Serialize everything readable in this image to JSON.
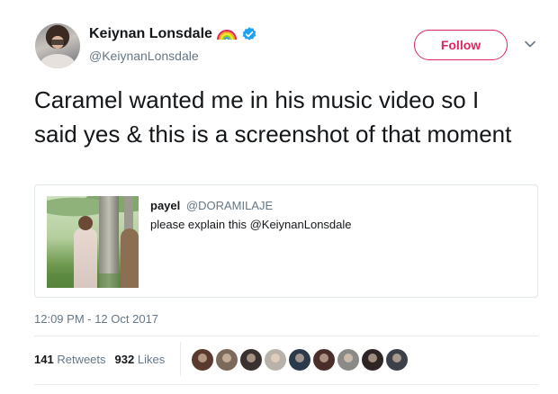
{
  "author": {
    "name": "Keiynan Lonsdale",
    "handle": "@KeiynanLonsdale",
    "verified": true
  },
  "follow_label": "Follow",
  "tweet_text": "Caramel wanted me in his music video so I said yes & this is a screenshot of that moment",
  "quoted_tweet": {
    "name": "payel",
    "handle": "@DORAMILAJE",
    "text": "please explain this @KeiynanLonsdale"
  },
  "timestamp": "12:09 PM - 12 Oct 2017",
  "stats": {
    "retweets_count": "141",
    "retweets_label": "Retweets",
    "likes_count": "932",
    "likes_label": "Likes"
  },
  "likers": [
    {
      "name": "liker-1",
      "color": "#5a3a2e"
    },
    {
      "name": "liker-2",
      "color": "#7b6a5c"
    },
    {
      "name": "liker-3",
      "color": "#3a3230"
    },
    {
      "name": "liker-4",
      "color": "#b8b2aa"
    },
    {
      "name": "liker-5",
      "color": "#2b3a4a"
    },
    {
      "name": "liker-6",
      "color": "#4a2e2a"
    },
    {
      "name": "liker-7",
      "color": "#8a8a86"
    },
    {
      "name": "liker-8",
      "color": "#2e2624"
    },
    {
      "name": "liker-9",
      "color": "#3c4048"
    }
  ],
  "colors": {
    "follow_accent": "#e0245e",
    "verified_blue": "#1da1f2",
    "muted_text": "#657786"
  },
  "icons": [
    "rainbow-icon",
    "verified-badge-icon",
    "chevron-down-icon"
  ]
}
